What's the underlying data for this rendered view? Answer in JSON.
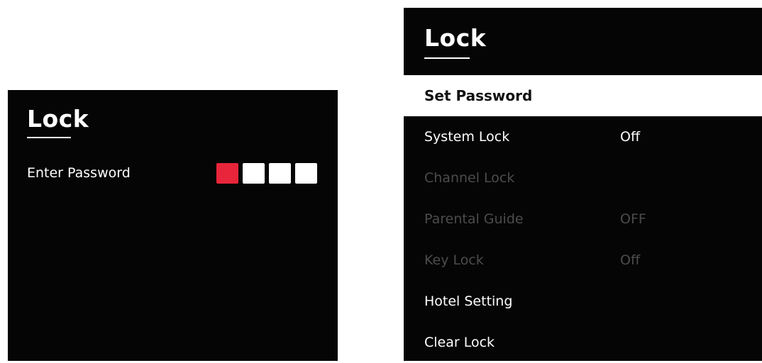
{
  "left_screen": {
    "title": "Lock",
    "password_label": "Enter Password",
    "pin": {
      "length": 4,
      "active_index": 0,
      "active_color": "#e8253a",
      "inactive_color": "#ffffff"
    }
  },
  "right_screen": {
    "title": "Lock",
    "menu": [
      {
        "label": "Set Password",
        "value": "",
        "state": "selected"
      },
      {
        "label": "System Lock",
        "value": "Off",
        "state": "enabled"
      },
      {
        "label": "Channel Lock",
        "value": "",
        "state": "disabled"
      },
      {
        "label": "Parental Guide",
        "value": "OFF",
        "state": "disabled"
      },
      {
        "label": "Key Lock",
        "value": "Off",
        "state": "disabled"
      },
      {
        "label": "Hotel Setting",
        "value": "",
        "state": "enabled"
      },
      {
        "label": "Clear Lock",
        "value": "",
        "state": "enabled"
      }
    ]
  },
  "colors": {
    "background": "#050505",
    "text": "#ffffff",
    "disabled_text": "#4c4c4c",
    "highlight_bg": "#ffffff",
    "highlight_text": "#111111"
  }
}
